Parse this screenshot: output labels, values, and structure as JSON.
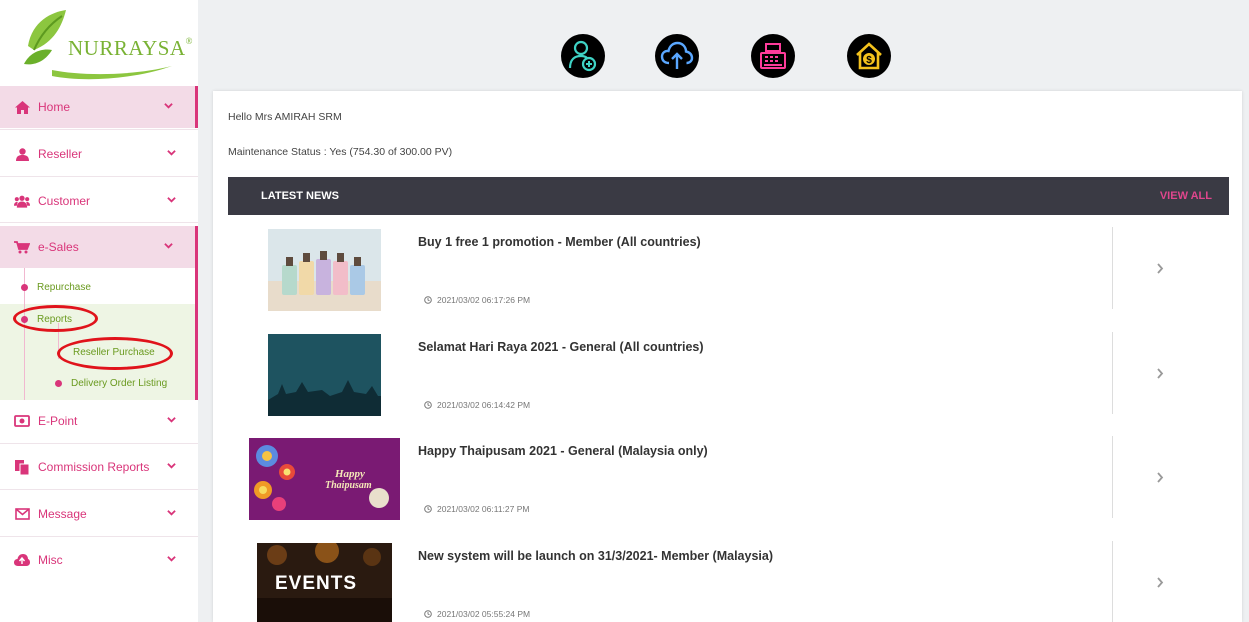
{
  "brand": {
    "name": "NURRAYSA",
    "reg_mark": "®"
  },
  "nav": {
    "home": "Home",
    "reseller": "Reseller",
    "customer": "Customer",
    "esales": "e-Sales",
    "submenu": {
      "repurchase": "Repurchase",
      "reports": "Reports",
      "reseller_purchase": "Reseller Purchase",
      "delivery_order_listing": "Delivery Order Listing"
    },
    "epoint": "E-Point",
    "commission_reports": "Commission Reports",
    "message": "Message",
    "misc": "Misc"
  },
  "main": {
    "greeting": "Hello Mrs AMIRAH SRM",
    "maintenance_status": "Maintenance Status : Yes (754.30 of 300.00 PV)",
    "news_header": {
      "title": "LATEST NEWS",
      "view_all": "VIEW ALL"
    },
    "news": [
      {
        "title": "Buy 1 free 1 promotion - Member (All countries)",
        "date": "2021/03/02 06:17:26 PM"
      },
      {
        "title": "Selamat Hari Raya 2021 - General (All countries)",
        "date": "2021/03/02 06:14:42 PM"
      },
      {
        "title": "Happy Thaipusam 2021 - General (Malaysia only)",
        "date": "2021/03/02 06:11:27 PM",
        "thumb_text_1": "Happy",
        "thumb_text_2": "Thaipusam"
      },
      {
        "title": "New system will be launch on 31/3/2021- Member (Malaysia)",
        "date": "2021/03/02 05:55:24 PM",
        "thumb_text": "EVENTS"
      }
    ]
  },
  "colors": {
    "accent": "#d9357a",
    "submenu_text": "#6a9a1f",
    "news_bar": "#3a3a44",
    "highlight": "#e0131b"
  },
  "icons": [
    "home-icon",
    "user-icon",
    "users-icon",
    "cart-icon",
    "money-icon",
    "documents-icon",
    "envelope-icon",
    "cloud-icon",
    "chevron-down-icon",
    "add-user-icon",
    "cloud-upload-icon",
    "cash-register-icon",
    "house-dollar-icon",
    "clock-icon",
    "chevron-right-icon"
  ]
}
